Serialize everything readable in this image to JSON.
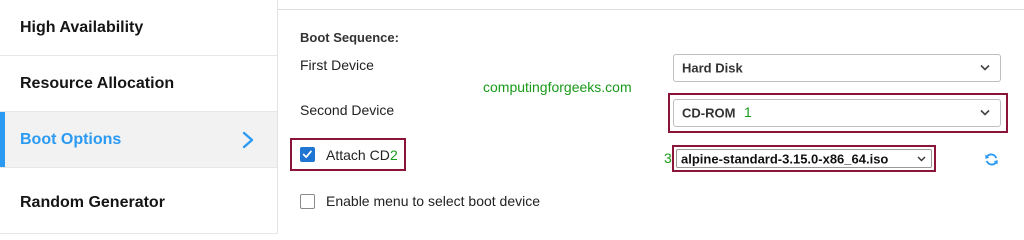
{
  "sidebar": {
    "items": [
      {
        "label": "High Availability"
      },
      {
        "label": "Resource Allocation"
      },
      {
        "label": "Boot Options"
      },
      {
        "label": "Random Generator"
      }
    ]
  },
  "boot": {
    "section_title": "Boot Sequence:",
    "first_device_label": "First Device",
    "first_device_value": "Hard Disk",
    "second_device_label": "Second Device",
    "second_device_value": "CD-ROM",
    "attach_cd_label": "Attach CD",
    "attach_cd_checked": true,
    "iso_value": "alpine-standard-3.15.0-x86_64.iso",
    "enable_menu_label": "Enable menu to select boot device",
    "enable_menu_checked": false
  },
  "annotations": {
    "watermark": "computingforgeeks.com",
    "num1": "1",
    "num2": "2",
    "num3": "3"
  },
  "colors": {
    "accent": "#2b9af3",
    "annotation_box": "#8b1538",
    "annotation_text": "#1a9a1a",
    "checkbox_checked": "#1f76d2"
  },
  "icons": {
    "sidebar_active_chevron": "chevron-right-icon",
    "select_caret": "chevron-down-icon",
    "refresh": "refresh-icon",
    "check": "check-icon"
  }
}
